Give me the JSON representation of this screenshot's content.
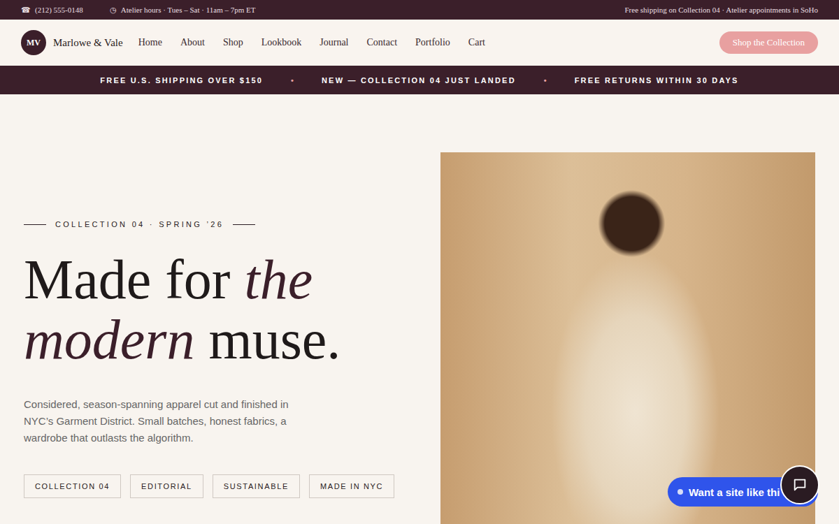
{
  "utility": {
    "phone_icon": "☎",
    "phone": "(212) 555-0148",
    "hours_icon": "◷",
    "hours": "Atelier hours · Tues – Sat · 11am – 7pm ET",
    "notice": "Free shipping on Collection 04 · Atelier appointments in SoHo"
  },
  "brand": {
    "monogram": "MV",
    "name": "Marlowe & Vale"
  },
  "nav": {
    "items": [
      "Home",
      "About",
      "Shop",
      "Lookbook",
      "Journal",
      "Contact",
      "Portfolio",
      "Cart"
    ],
    "cta": "Shop the Collection"
  },
  "announcements": {
    "items": [
      "FREE U.S. SHIPPING OVER $150",
      "NEW — COLLECTION 04 JUST LANDED",
      "FREE RETURNS WITHIN 30 DAYS"
    ],
    "separator": "•"
  },
  "hero": {
    "eyebrow": "COLLECTION 04 · SPRING ’26",
    "headline": [
      [
        {
          "text": "Made for ",
          "italic": false
        },
        {
          "text": "the",
          "italic": true
        }
      ],
      [
        {
          "text": "modern",
          "italic": true
        },
        {
          "text": " muse.",
          "italic": false
        }
      ]
    ],
    "description": "Considered, season-spanning apparel cut and finished in NYC’s Garment District. Small batches, honest fabrics, a wardrobe that outlasts the algorithm.",
    "tags": [
      "COLLECTION 04",
      "EDITORIAL",
      "SUSTAINABLE",
      "MADE IN NYC"
    ]
  },
  "chat": {
    "label": "Want a site like thi"
  }
}
